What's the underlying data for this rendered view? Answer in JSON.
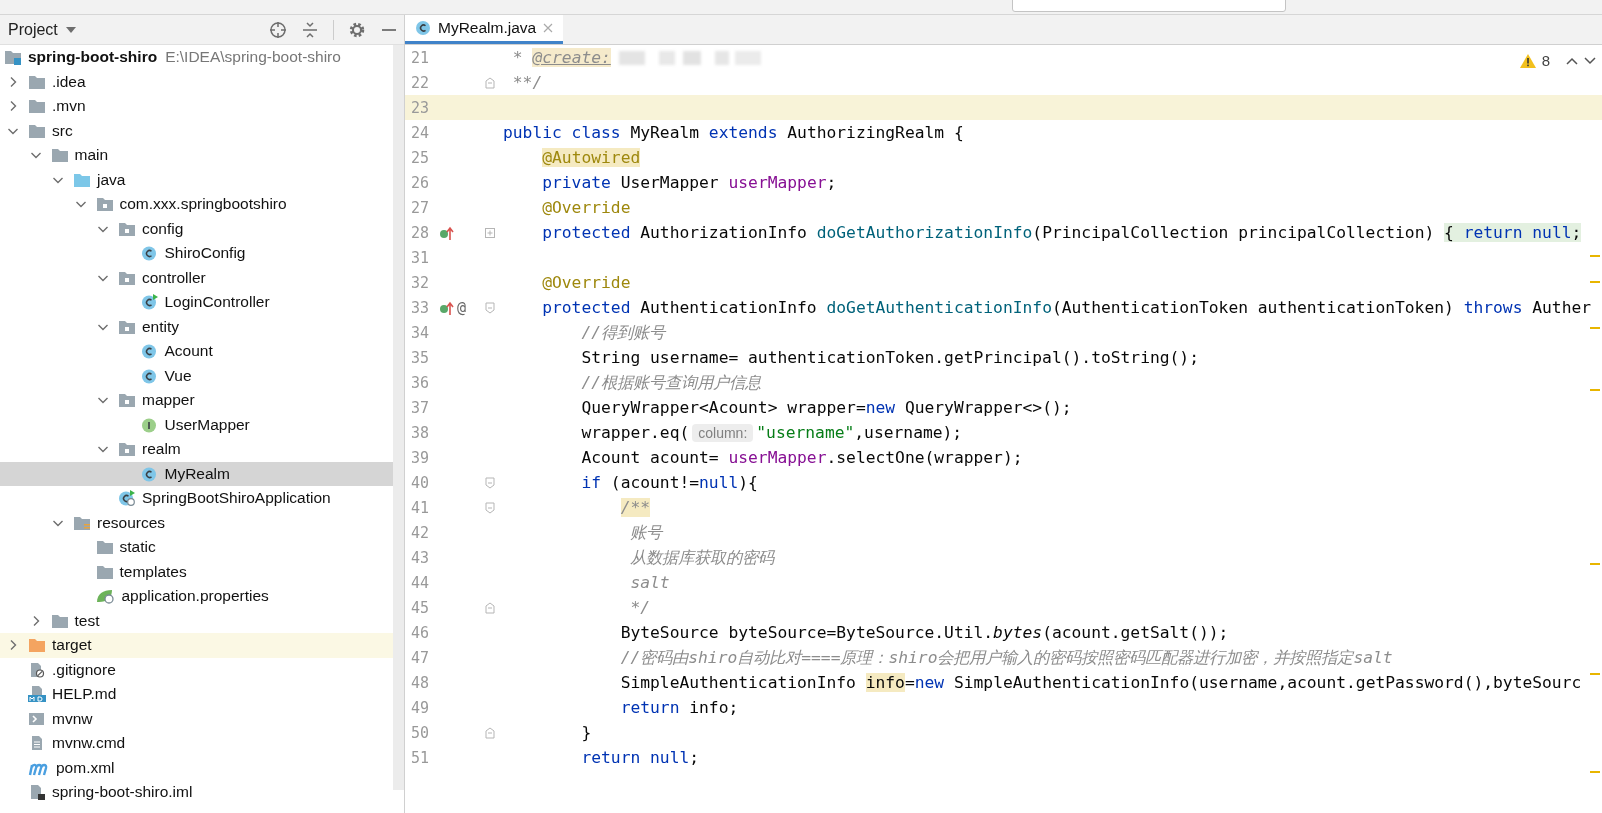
{
  "project_panel": {
    "title": "Project",
    "tree": [
      {
        "label": "spring-boot-shiro",
        "path": "E:\\IDEA\\spring-boot-shiro",
        "kind": "module",
        "selected": false,
        "children": [
          {
            "label": ".idea",
            "kind": "folder",
            "expanded": false,
            "selected": false
          },
          {
            "label": ".mvn",
            "kind": "folder",
            "expanded": false,
            "selected": false
          },
          {
            "label": "src",
            "kind": "folder",
            "expanded": true,
            "selected": false,
            "children": [
              {
                "label": "main",
                "kind": "folder",
                "expanded": true,
                "selected": false,
                "children": [
                  {
                    "label": "java",
                    "kind": "source-folder",
                    "expanded": true,
                    "selected": false,
                    "children": [
                      {
                        "label": "com.xxx.springbootshiro",
                        "kind": "package",
                        "expanded": true,
                        "selected": false,
                        "children": [
                          {
                            "label": "config",
                            "kind": "package",
                            "expanded": true,
                            "selected": false,
                            "children": [
                              {
                                "label": "ShiroConfig",
                                "kind": "class",
                                "selected": false
                              }
                            ]
                          },
                          {
                            "label": "controller",
                            "kind": "package",
                            "expanded": true,
                            "selected": false,
                            "children": [
                              {
                                "label": "LoginController",
                                "kind": "runnable-class",
                                "selected": false
                              }
                            ]
                          },
                          {
                            "label": "entity",
                            "kind": "package",
                            "expanded": true,
                            "selected": false,
                            "children": [
                              {
                                "label": "Acount",
                                "kind": "class",
                                "selected": false
                              },
                              {
                                "label": "Vue",
                                "kind": "class",
                                "selected": false
                              }
                            ]
                          },
                          {
                            "label": "mapper",
                            "kind": "package",
                            "expanded": true,
                            "selected": false,
                            "children": [
                              {
                                "label": "UserMapper",
                                "kind": "interface",
                                "selected": false
                              }
                            ]
                          },
                          {
                            "label": "realm",
                            "kind": "package",
                            "expanded": true,
                            "selected": false,
                            "children": [
                              {
                                "label": "MyRealm",
                                "kind": "class",
                                "selected": true
                              }
                            ]
                          },
                          {
                            "label": "SpringBootShiroApplication",
                            "kind": "app-class",
                            "selected": false
                          }
                        ]
                      }
                    ]
                  },
                  {
                    "label": "resources",
                    "kind": "resources-folder",
                    "expanded": true,
                    "selected": false,
                    "children": [
                      {
                        "label": "static",
                        "kind": "folder",
                        "selected": false
                      },
                      {
                        "label": "templates",
                        "kind": "folder",
                        "selected": false
                      },
                      {
                        "label": "application.properties",
                        "kind": "spring-config",
                        "selected": false
                      }
                    ]
                  }
                ]
              },
              {
                "label": "test",
                "kind": "folder",
                "expanded": false,
                "selected": false
              }
            ]
          },
          {
            "label": "target",
            "kind": "excluded-folder",
            "expanded": false,
            "selected": false
          },
          {
            "label": ".gitignore",
            "kind": "ignore-file",
            "selected": false
          },
          {
            "label": "HELP.md",
            "kind": "markdown",
            "selected": false
          },
          {
            "label": "mvnw",
            "kind": "shell-script",
            "selected": false
          },
          {
            "label": "mvnw.cmd",
            "kind": "text-file",
            "selected": false
          },
          {
            "label": "pom.xml",
            "kind": "maven",
            "selected": false
          },
          {
            "label": "spring-boot-shiro.iml",
            "kind": "module-file",
            "selected": false
          }
        ]
      }
    ]
  },
  "editor": {
    "tabs": [
      {
        "label": "MyRealm.java",
        "selected": true
      }
    ],
    "warnings": "8",
    "lines": [
      {
        "number": "21",
        "current": false,
        "tokens": [
          {
            "kind": "doc",
            "text": " * "
          },
          {
            "kind": "doc-tag",
            "text": "@create:"
          },
          {
            "kind": "redacted"
          }
        ]
      },
      {
        "number": "22",
        "current": false,
        "gutter": [
          {
            "kind": "fold-end"
          }
        ],
        "tokens": [
          {
            "kind": "doc",
            "text": " **/"
          }
        ]
      },
      {
        "number": "23",
        "current": true
      },
      {
        "number": "24",
        "current": false,
        "tokens": [
          {
            "kind": "keyword",
            "text": "public class "
          },
          {
            "kind": "plain",
            "text": "MyRealm "
          },
          {
            "kind": "keyword",
            "text": "extends "
          },
          {
            "kind": "plain",
            "text": "AuthorizingRealm {"
          }
        ]
      },
      {
        "number": "25",
        "current": false,
        "tokens": [
          {
            "kind": "annotation-hl",
            "text": "    @Autowired"
          }
        ]
      },
      {
        "number": "26",
        "current": false,
        "tokens": [
          {
            "kind": "keyword",
            "text": "    private "
          },
          {
            "kind": "plain",
            "text": "UserMapper "
          },
          {
            "kind": "field",
            "text": "userMapper"
          },
          {
            "kind": "plain",
            "text": ";"
          }
        ]
      },
      {
        "number": "27",
        "current": false,
        "tokens": [
          {
            "kind": "annotation",
            "text": "    @Override"
          }
        ]
      },
      {
        "number": "28",
        "current": false,
        "gutter": [
          {
            "kind": "override"
          },
          {
            "kind": "fold-collapsed"
          }
        ],
        "tokens": [
          {
            "kind": "keyword",
            "text": "    protected "
          },
          {
            "kind": "plain",
            "text": "AuthorizationInfo "
          },
          {
            "kind": "method",
            "text": "doGetAuthorizationInfo"
          },
          {
            "kind": "plain",
            "text": "(PrincipalCollection principalCollection) "
          },
          {
            "kind": "fold",
            "text": "{ "
          },
          {
            "kind": "fold-keyword",
            "text": "return null"
          },
          {
            "kind": "fold",
            "text": ";"
          }
        ]
      },
      {
        "number": "31",
        "current": false
      },
      {
        "number": "32",
        "current": false,
        "tokens": [
          {
            "kind": "annotation",
            "text": "    @Override"
          }
        ]
      },
      {
        "number": "33",
        "current": false,
        "gutter": [
          {
            "kind": "override"
          },
          {
            "kind": "mark",
            "text": "@"
          },
          {
            "kind": "fold-start"
          }
        ],
        "tokens": [
          {
            "kind": "keyword",
            "text": "    protected "
          },
          {
            "kind": "plain",
            "text": "AuthenticationInfo "
          },
          {
            "kind": "method",
            "text": "doGetAuthenticationInfo"
          },
          {
            "kind": "plain",
            "text": "(AuthenticationToken authenticationToken) "
          },
          {
            "kind": "keyword",
            "text": "throws "
          },
          {
            "kind": "plain",
            "text": "Auther"
          }
        ]
      },
      {
        "number": "34",
        "current": false,
        "tokens": [
          {
            "kind": "comment",
            "text": "        //得到账号"
          }
        ]
      },
      {
        "number": "35",
        "current": false,
        "tokens": [
          {
            "kind": "plain",
            "text": "        String username= authenticationToken.getPrincipal().toString();"
          }
        ]
      },
      {
        "number": "36",
        "current": false,
        "tokens": [
          {
            "kind": "comment",
            "text": "        //根据账号查询用户信息"
          }
        ]
      },
      {
        "number": "37",
        "current": false,
        "tokens": [
          {
            "kind": "plain",
            "text": "        QueryWrapper<Acount> wrapper="
          },
          {
            "kind": "keyword",
            "text": "new"
          },
          {
            "kind": "plain",
            "text": " QueryWrapper<>();"
          }
        ]
      },
      {
        "number": "38",
        "current": false,
        "tokens": [
          {
            "kind": "plain",
            "text": "        wrapper.eq("
          },
          {
            "kind": "hint",
            "text": "column:"
          },
          {
            "kind": "string",
            "text": "\"username\""
          },
          {
            "kind": "plain",
            "text": ",username);"
          }
        ]
      },
      {
        "number": "39",
        "current": false,
        "tokens": [
          {
            "kind": "plain",
            "text": "        Acount acount= "
          },
          {
            "kind": "field",
            "text": "userMapper"
          },
          {
            "kind": "plain",
            "text": ".selectOne(wrapper);"
          }
        ]
      },
      {
        "number": "40",
        "current": false,
        "gutter": [
          {
            "kind": "fold-start"
          }
        ],
        "tokens": [
          {
            "kind": "keyword",
            "text": "        if"
          },
          {
            "kind": "plain",
            "text": " (acount!="
          },
          {
            "kind": "keyword",
            "text": "null"
          },
          {
            "kind": "plain",
            "text": "){"
          }
        ]
      },
      {
        "number": "41",
        "current": false,
        "gutter": [
          {
            "kind": "fold-start"
          }
        ],
        "tokens": [
          {
            "kind": "doc-hl",
            "text": "            /**"
          }
        ]
      },
      {
        "number": "42",
        "current": false,
        "tokens": [
          {
            "kind": "doc",
            "text": "             账号"
          }
        ]
      },
      {
        "number": "43",
        "current": false,
        "tokens": [
          {
            "kind": "doc",
            "text": "             从数据库获取的密码"
          }
        ]
      },
      {
        "number": "44",
        "current": false,
        "tokens": [
          {
            "kind": "doc",
            "text": "             salt"
          }
        ]
      },
      {
        "number": "45",
        "current": false,
        "gutter": [
          {
            "kind": "fold-end"
          }
        ],
        "tokens": [
          {
            "kind": "doc",
            "text": "             */"
          }
        ]
      },
      {
        "number": "46",
        "current": false,
        "tokens": [
          {
            "kind": "plain",
            "text": "            ByteSource byteSource=ByteSource.Util."
          },
          {
            "kind": "static",
            "text": "bytes"
          },
          {
            "kind": "plain",
            "text": "(acount.getSalt());"
          }
        ]
      },
      {
        "number": "47",
        "current": false,
        "tokens": [
          {
            "kind": "comment",
            "text": "            //密码由shiro自动比对====原理：shiro会把用户输入的密码按照密码匹配器进行加密，并按照指定salt"
          }
        ]
      },
      {
        "number": "48",
        "current": false,
        "tokens": [
          {
            "kind": "plain",
            "text": "            SimpleAuthenticationInfo "
          },
          {
            "kind": "usage-hl",
            "text": "info"
          },
          {
            "kind": "plain",
            "text": "="
          },
          {
            "kind": "keyword",
            "text": "new"
          },
          {
            "kind": "plain",
            "text": " SimpleAuthenticationInfo(username,acount.getPassword(),byteSourc"
          }
        ]
      },
      {
        "number": "49",
        "current": false,
        "tokens": [
          {
            "kind": "keyword",
            "text": "            return"
          },
          {
            "kind": "plain",
            "text": " info;"
          }
        ]
      },
      {
        "number": "50",
        "current": false,
        "gutter": [
          {
            "kind": "fold-end"
          }
        ],
        "tokens": [
          {
            "kind": "plain",
            "text": "        }"
          }
        ]
      },
      {
        "number": "51",
        "current": false,
        "tokens": [
          {
            "kind": "keyword",
            "text": "        return null"
          },
          {
            "kind": "plain",
            "text": ";"
          }
        ]
      }
    ]
  }
}
